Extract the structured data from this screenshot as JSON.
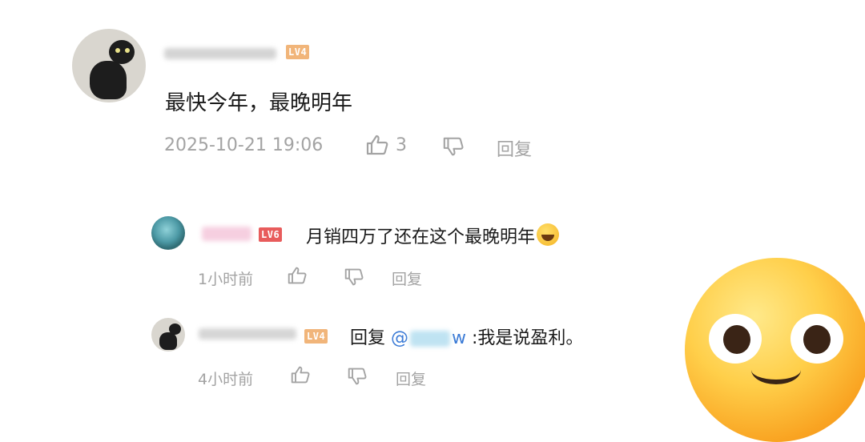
{
  "comment": {
    "level": "LV4",
    "text": "最快今年，最晚明年",
    "timestamp": "2025-10-21 19:06",
    "like_count": "3",
    "reply_label": "回复"
  },
  "replies": [
    {
      "level": "LV6",
      "text": "月销四万了还在这个最晚明年",
      "time": "1小时前",
      "reply_label": "回复"
    },
    {
      "level": "LV4",
      "prefix": "回复",
      "mention_at": "@",
      "mention_tail": "w",
      "text": ":我是说盈利。",
      "time": "4小时前",
      "reply_label": "回复"
    }
  ],
  "icons": {
    "like": "thumbs-up-icon",
    "dislike": "thumbs-down-icon",
    "laugh_emoji": "tears-of-joy-emoji",
    "sticker": "smiling-face-sticker"
  },
  "colors": {
    "meta_text": "#a3a3a3",
    "lv4_badge": "#f1b57a",
    "lv6_badge": "#e85c5c",
    "mention": "#3b7bd6"
  }
}
